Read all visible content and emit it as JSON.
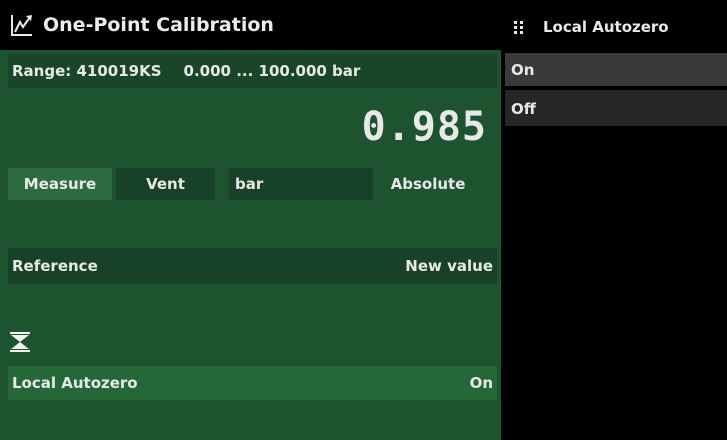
{
  "header": {
    "title": "One-Point Calibration",
    "icon": "calibration-icon"
  },
  "range": {
    "label": "Range: 410019KS",
    "span": "0.000 ... 100.000 bar"
  },
  "reading": {
    "value": "0.985"
  },
  "controls": {
    "measure": "Measure",
    "vent": "Vent",
    "unit": "bar",
    "mode": "Absolute"
  },
  "reference": {
    "label": "Reference",
    "value": "New value"
  },
  "local_autozero": {
    "label": "Local Autozero",
    "value": "On",
    "icon": "autozero-icon"
  },
  "panel": {
    "title": "Local Autozero",
    "icon": "grip-icon",
    "options": [
      {
        "label": "On",
        "selected": true
      },
      {
        "label": "Off",
        "selected": false
      }
    ]
  },
  "colors": {
    "background": "#1e5330",
    "selected_button": "#2b6b3f",
    "panel_bg": "#000000",
    "selected_option": "#3a3a3a"
  }
}
